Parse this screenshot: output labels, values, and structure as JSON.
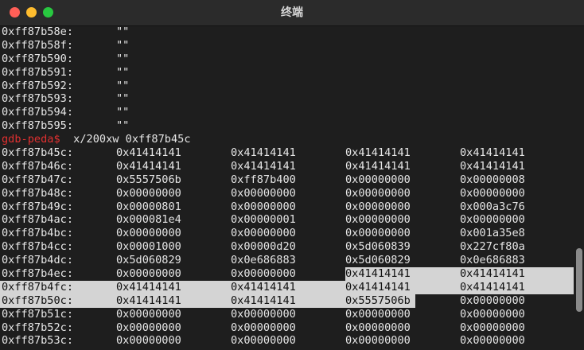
{
  "window": {
    "title": "终端"
  },
  "prompt": {
    "label": "gdb-peda$",
    "command": " x/200xw 0xff87b45c"
  },
  "string_rows": [
    {
      "addr": "0xff87b58e:",
      "val": "\"\""
    },
    {
      "addr": "0xff87b58f:",
      "val": "\"\""
    },
    {
      "addr": "0xff87b590:",
      "val": "\"\""
    },
    {
      "addr": "0xff87b591:",
      "val": "\"\""
    },
    {
      "addr": "0xff87b592:",
      "val": "\"\""
    },
    {
      "addr": "0xff87b593:",
      "val": "\"\""
    },
    {
      "addr": "0xff87b594:",
      "val": "\"\""
    },
    {
      "addr": "0xff87b595:",
      "val": "\"\""
    }
  ],
  "mem_rows": [
    {
      "addr": "0xff87b45c:",
      "w": [
        "0x41414141",
        "0x41414141",
        "0x41414141",
        "0x41414141"
      ]
    },
    {
      "addr": "0xff87b46c:",
      "w": [
        "0x41414141",
        "0x41414141",
        "0x41414141",
        "0x41414141"
      ]
    },
    {
      "addr": "0xff87b47c:",
      "w": [
        "0x5557506b",
        "0xff87b400",
        "0x00000000",
        "0x00000008"
      ]
    },
    {
      "addr": "0xff87b48c:",
      "w": [
        "0x00000000",
        "0x00000000",
        "0x00000000",
        "0x00000000"
      ]
    },
    {
      "addr": "0xff87b49c:",
      "w": [
        "0x00000801",
        "0x00000000",
        "0x00000000",
        "0x000a3c76"
      ]
    },
    {
      "addr": "0xff87b4ac:",
      "w": [
        "0x000081e4",
        "0x00000001",
        "0x00000000",
        "0x00000000"
      ]
    },
    {
      "addr": "0xff87b4bc:",
      "w": [
        "0x00000000",
        "0x00000000",
        "0x00000000",
        "0x001a35e8"
      ]
    },
    {
      "addr": "0xff87b4cc:",
      "w": [
        "0x00001000",
        "0x00000d20",
        "0x5d060839",
        "0x227cf80a"
      ]
    },
    {
      "addr": "0xff87b4dc:",
      "w": [
        "0x5d060829",
        "0x0e686883",
        "0x5d060829",
        "0x0e686883"
      ]
    },
    {
      "addr": "0xff87b4ec:",
      "w": [
        "0x00000000",
        "0x00000000",
        "0x41414141",
        "0x41414141"
      ]
    },
    {
      "addr": "0xff87b4fc:",
      "w": [
        "0x41414141",
        "0x41414141",
        "0x41414141",
        "0x41414141"
      ]
    },
    {
      "addr": "0xff87b50c:",
      "w": [
        "0x41414141",
        "0x41414141",
        "0x5557506b",
        "0x00000000"
      ]
    },
    {
      "addr": "0xff87b51c:",
      "w": [
        "0x00000000",
        "0x00000000",
        "0x00000000",
        "0x00000000"
      ]
    },
    {
      "addr": "0xff87b52c:",
      "w": [
        "0x00000000",
        "0x00000000",
        "0x00000000",
        "0x00000000"
      ]
    },
    {
      "addr": "0xff87b53c:",
      "w": [
        "0x00000000",
        "0x00000000",
        "0x00000000",
        "0x00000000"
      ]
    }
  ],
  "colors": {
    "prompt": "#e03030",
    "selection": "#d4d4d4",
    "background": "#1e1e1e"
  }
}
